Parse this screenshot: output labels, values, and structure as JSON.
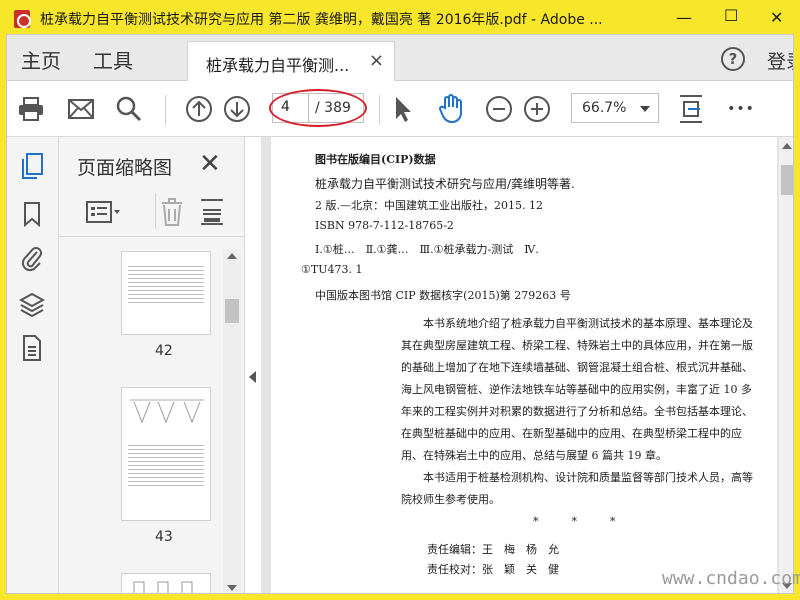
{
  "window": {
    "title": "桩承载力自平衡测试技术研究与应用 第二版 龚维明，戴国亮 著 2016年版.pdf - Adobe ...",
    "minimize": "—",
    "maximize": "☐",
    "close": "✕"
  },
  "tabs": {
    "home": "主页",
    "tools": "工具",
    "doc_tab": "桩承载力自平衡测...",
    "doc_close": "×",
    "help": "?",
    "login": "登录"
  },
  "toolbar": {
    "current_page": "4",
    "total_pages": "/ 389",
    "zoom": "66.7%",
    "more": "•••"
  },
  "thumbnails": {
    "title": "页面缩略图",
    "close": "✕",
    "pages": [
      "42",
      "43"
    ]
  },
  "document": {
    "cip_heading": "图书在版编目(CIP)数据",
    "line1": "桩承载力自平衡测试技术研究与应用/龚维明等著.",
    "line2": "2 版.—北京：中国建筑工业出版社，2015. 12",
    "line3": "ISBN 978-7-112-18765-2",
    "line4": "Ⅰ.①桩…　Ⅱ.①龚…　Ⅲ.①桩承载力-测试　Ⅳ.",
    "line5": "①TU473. 1",
    "line6": "中国版本图书馆 CIP 数据核字(2015)第 279263 号",
    "para1": "本书系统地介绍了桩承载力自平衡测试技术的基本原理、基本理论及其在典型房屋建筑工程、桥梁工程、特殊岩土中的具体应用，并在第一版的基础上增加了在地下连续墙基础、钢管混凝土组合桩、根式沉井基础、海上风电钢管桩、逆作法地铁车站等基础中的应用实例，丰富了近 10 多年来的工程实例并对积累的数据进行了分析和总结。全书包括基本理论、在典型桩基础中的应用、在新型基础中的应用、在典型桥梁工程中的应用、在特殊岩土中的应用、总结与展望 6 篇共 19 章。",
    "para2": "本书适用于桩基检测机构、设计院和质量监督等部门技术人员，高等院校师生参考使用。",
    "stars": "*　　　*　　　*",
    "editor": "责任编辑：王　梅　杨　允",
    "proofreader": "责任校对：张　颖　关　健"
  },
  "watermark": "www.cndao.com"
}
